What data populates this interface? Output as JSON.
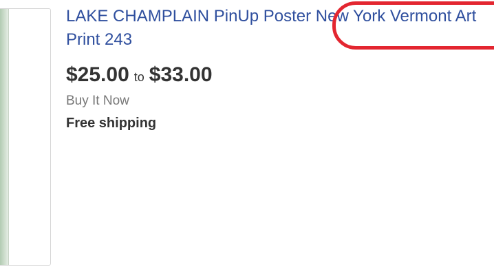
{
  "listing": {
    "title": "LAKE CHAMPLAIN PinUp Poster New York Vermont Art Print 243",
    "price_from": "$25.00",
    "price_separator": "to",
    "price_to": "$33.00",
    "buy_format": "Buy It Now",
    "shipping": "Free shipping"
  },
  "colors": {
    "title_link": "#2f4f9e",
    "price": "#333333",
    "secondary_text": "#777777",
    "highlight": "#e32630"
  }
}
